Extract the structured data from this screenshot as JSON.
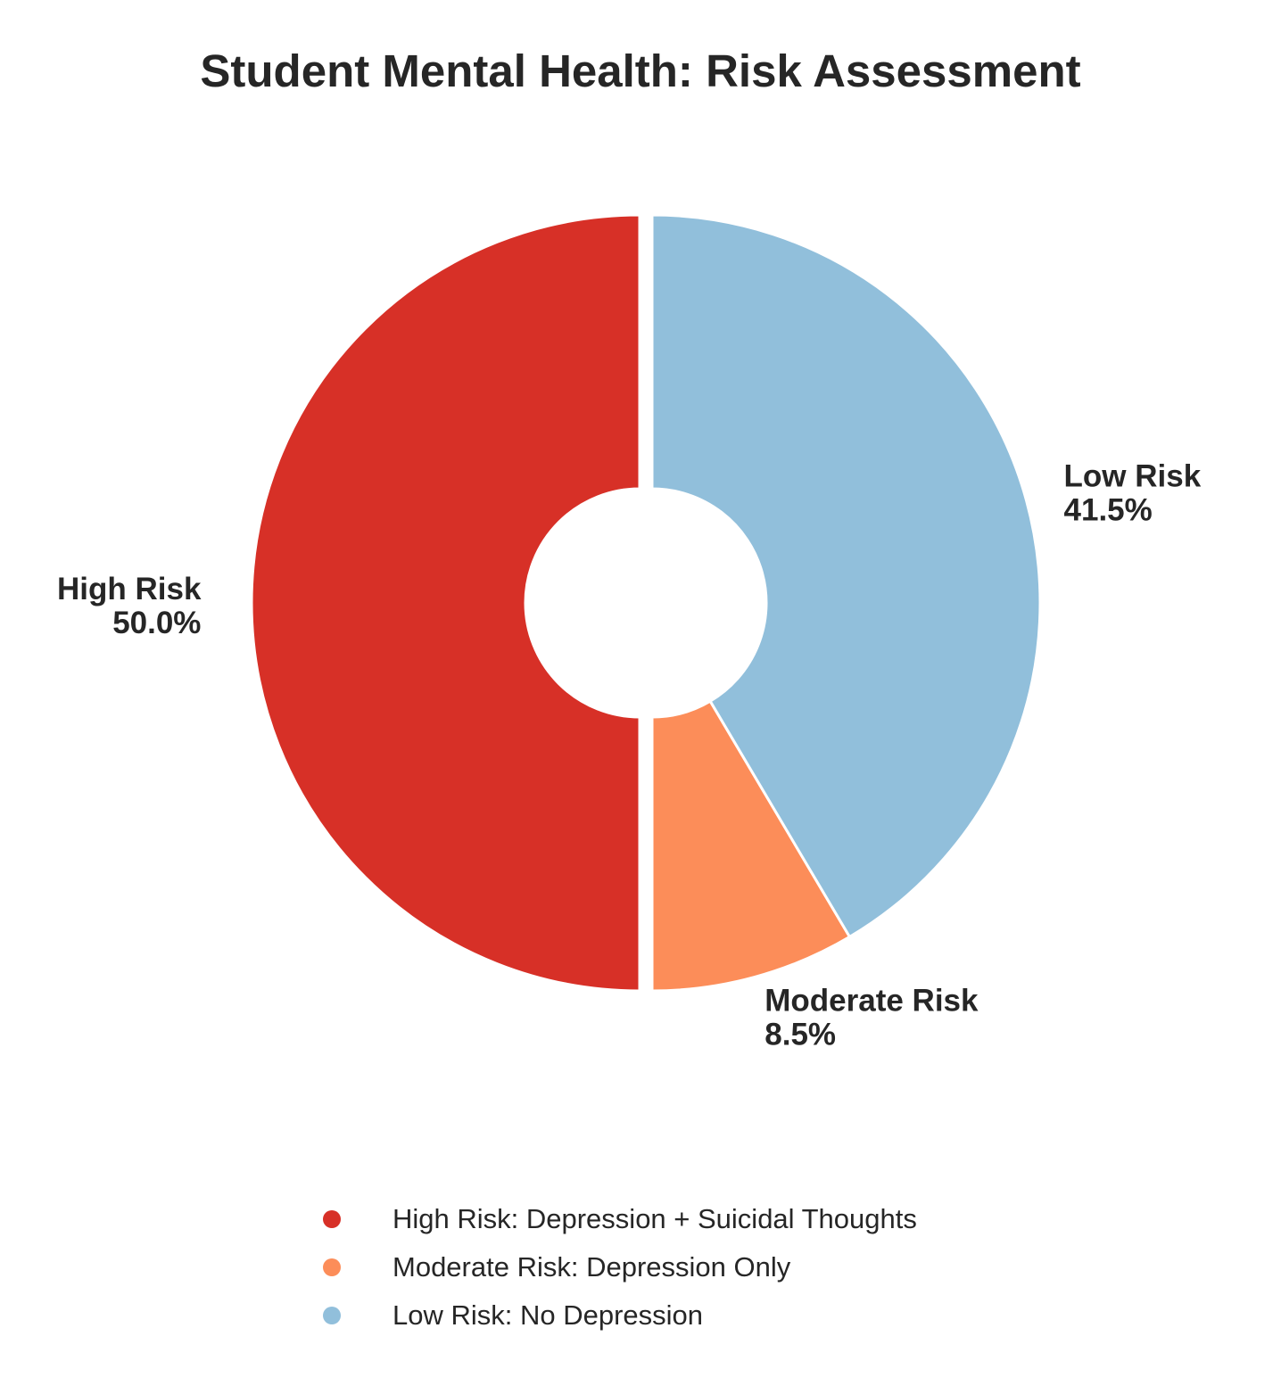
{
  "chart_data": {
    "type": "pie",
    "title": "Student Mental Health: Risk Assessment",
    "slices": [
      {
        "label": "High Risk",
        "value": 50.0,
        "display": "50.0%",
        "color": "#d73027",
        "exploded": true
      },
      {
        "label": "Moderate Risk",
        "value": 8.5,
        "display": "8.5%",
        "color": "#fc8d59",
        "exploded": false
      },
      {
        "label": "Low Risk",
        "value": 41.5,
        "display": "41.5%",
        "color": "#91bfdb",
        "exploded": false
      }
    ],
    "legend": {
      "placement": "bottom",
      "entries": [
        {
          "label": "High Risk: Depression + Suicidal Thoughts",
          "color": "#d73027"
        },
        {
          "label": "Moderate Risk: Depression Only",
          "color": "#fc8d59"
        },
        {
          "label": "Low Risk: No Depression",
          "color": "#91bfdb"
        }
      ]
    },
    "donut": true
  }
}
